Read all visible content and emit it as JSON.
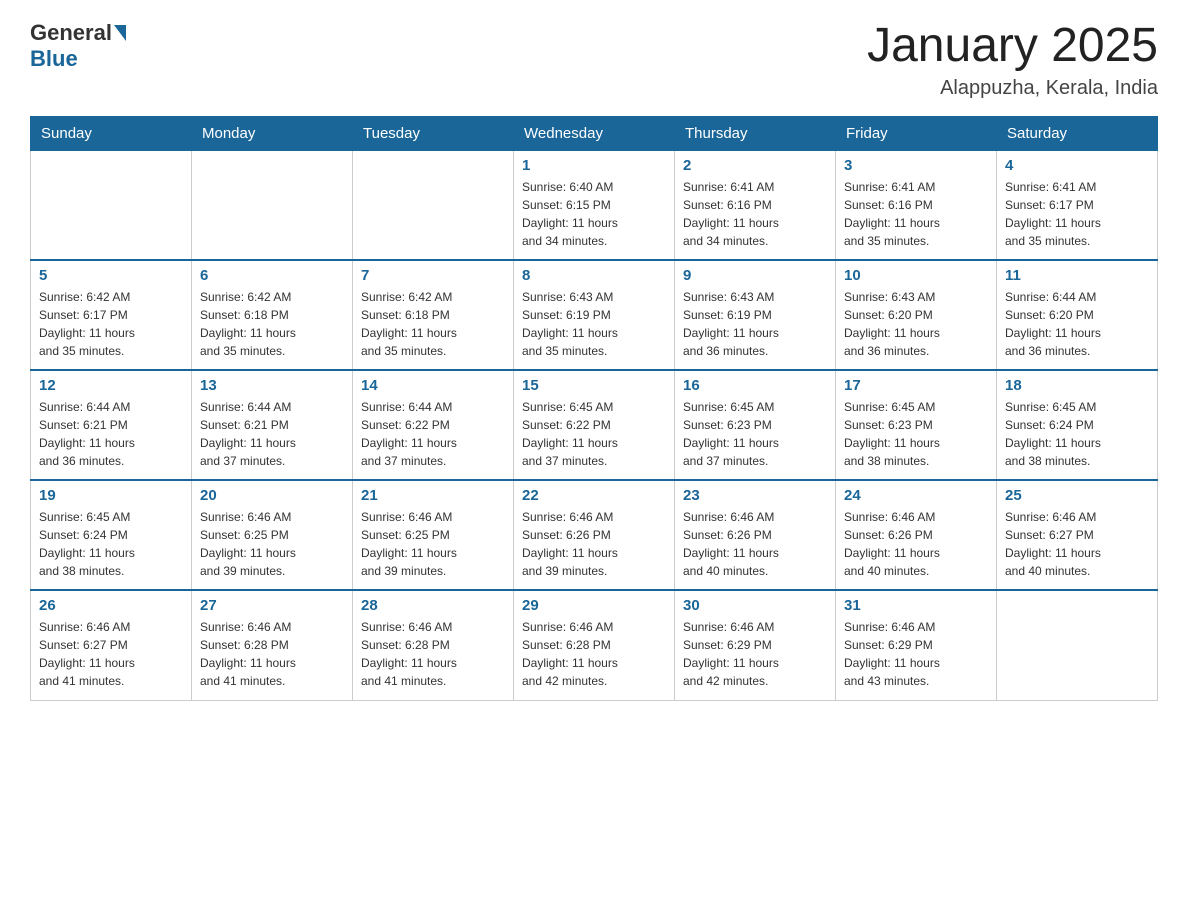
{
  "header": {
    "logo_general": "General",
    "logo_blue": "Blue",
    "month_title": "January 2025",
    "location": "Alappuzha, Kerala, India"
  },
  "days_of_week": [
    "Sunday",
    "Monday",
    "Tuesday",
    "Wednesday",
    "Thursday",
    "Friday",
    "Saturday"
  ],
  "weeks": [
    [
      {
        "day": "",
        "info": ""
      },
      {
        "day": "",
        "info": ""
      },
      {
        "day": "",
        "info": ""
      },
      {
        "day": "1",
        "info": "Sunrise: 6:40 AM\nSunset: 6:15 PM\nDaylight: 11 hours\nand 34 minutes."
      },
      {
        "day": "2",
        "info": "Sunrise: 6:41 AM\nSunset: 6:16 PM\nDaylight: 11 hours\nand 34 minutes."
      },
      {
        "day": "3",
        "info": "Sunrise: 6:41 AM\nSunset: 6:16 PM\nDaylight: 11 hours\nand 35 minutes."
      },
      {
        "day": "4",
        "info": "Sunrise: 6:41 AM\nSunset: 6:17 PM\nDaylight: 11 hours\nand 35 minutes."
      }
    ],
    [
      {
        "day": "5",
        "info": "Sunrise: 6:42 AM\nSunset: 6:17 PM\nDaylight: 11 hours\nand 35 minutes."
      },
      {
        "day": "6",
        "info": "Sunrise: 6:42 AM\nSunset: 6:18 PM\nDaylight: 11 hours\nand 35 minutes."
      },
      {
        "day": "7",
        "info": "Sunrise: 6:42 AM\nSunset: 6:18 PM\nDaylight: 11 hours\nand 35 minutes."
      },
      {
        "day": "8",
        "info": "Sunrise: 6:43 AM\nSunset: 6:19 PM\nDaylight: 11 hours\nand 35 minutes."
      },
      {
        "day": "9",
        "info": "Sunrise: 6:43 AM\nSunset: 6:19 PM\nDaylight: 11 hours\nand 36 minutes."
      },
      {
        "day": "10",
        "info": "Sunrise: 6:43 AM\nSunset: 6:20 PM\nDaylight: 11 hours\nand 36 minutes."
      },
      {
        "day": "11",
        "info": "Sunrise: 6:44 AM\nSunset: 6:20 PM\nDaylight: 11 hours\nand 36 minutes."
      }
    ],
    [
      {
        "day": "12",
        "info": "Sunrise: 6:44 AM\nSunset: 6:21 PM\nDaylight: 11 hours\nand 36 minutes."
      },
      {
        "day": "13",
        "info": "Sunrise: 6:44 AM\nSunset: 6:21 PM\nDaylight: 11 hours\nand 37 minutes."
      },
      {
        "day": "14",
        "info": "Sunrise: 6:44 AM\nSunset: 6:22 PM\nDaylight: 11 hours\nand 37 minutes."
      },
      {
        "day": "15",
        "info": "Sunrise: 6:45 AM\nSunset: 6:22 PM\nDaylight: 11 hours\nand 37 minutes."
      },
      {
        "day": "16",
        "info": "Sunrise: 6:45 AM\nSunset: 6:23 PM\nDaylight: 11 hours\nand 37 minutes."
      },
      {
        "day": "17",
        "info": "Sunrise: 6:45 AM\nSunset: 6:23 PM\nDaylight: 11 hours\nand 38 minutes."
      },
      {
        "day": "18",
        "info": "Sunrise: 6:45 AM\nSunset: 6:24 PM\nDaylight: 11 hours\nand 38 minutes."
      }
    ],
    [
      {
        "day": "19",
        "info": "Sunrise: 6:45 AM\nSunset: 6:24 PM\nDaylight: 11 hours\nand 38 minutes."
      },
      {
        "day": "20",
        "info": "Sunrise: 6:46 AM\nSunset: 6:25 PM\nDaylight: 11 hours\nand 39 minutes."
      },
      {
        "day": "21",
        "info": "Sunrise: 6:46 AM\nSunset: 6:25 PM\nDaylight: 11 hours\nand 39 minutes."
      },
      {
        "day": "22",
        "info": "Sunrise: 6:46 AM\nSunset: 6:26 PM\nDaylight: 11 hours\nand 39 minutes."
      },
      {
        "day": "23",
        "info": "Sunrise: 6:46 AM\nSunset: 6:26 PM\nDaylight: 11 hours\nand 40 minutes."
      },
      {
        "day": "24",
        "info": "Sunrise: 6:46 AM\nSunset: 6:26 PM\nDaylight: 11 hours\nand 40 minutes."
      },
      {
        "day": "25",
        "info": "Sunrise: 6:46 AM\nSunset: 6:27 PM\nDaylight: 11 hours\nand 40 minutes."
      }
    ],
    [
      {
        "day": "26",
        "info": "Sunrise: 6:46 AM\nSunset: 6:27 PM\nDaylight: 11 hours\nand 41 minutes."
      },
      {
        "day": "27",
        "info": "Sunrise: 6:46 AM\nSunset: 6:28 PM\nDaylight: 11 hours\nand 41 minutes."
      },
      {
        "day": "28",
        "info": "Sunrise: 6:46 AM\nSunset: 6:28 PM\nDaylight: 11 hours\nand 41 minutes."
      },
      {
        "day": "29",
        "info": "Sunrise: 6:46 AM\nSunset: 6:28 PM\nDaylight: 11 hours\nand 42 minutes."
      },
      {
        "day": "30",
        "info": "Sunrise: 6:46 AM\nSunset: 6:29 PM\nDaylight: 11 hours\nand 42 minutes."
      },
      {
        "day": "31",
        "info": "Sunrise: 6:46 AM\nSunset: 6:29 PM\nDaylight: 11 hours\nand 43 minutes."
      },
      {
        "day": "",
        "info": ""
      }
    ]
  ]
}
